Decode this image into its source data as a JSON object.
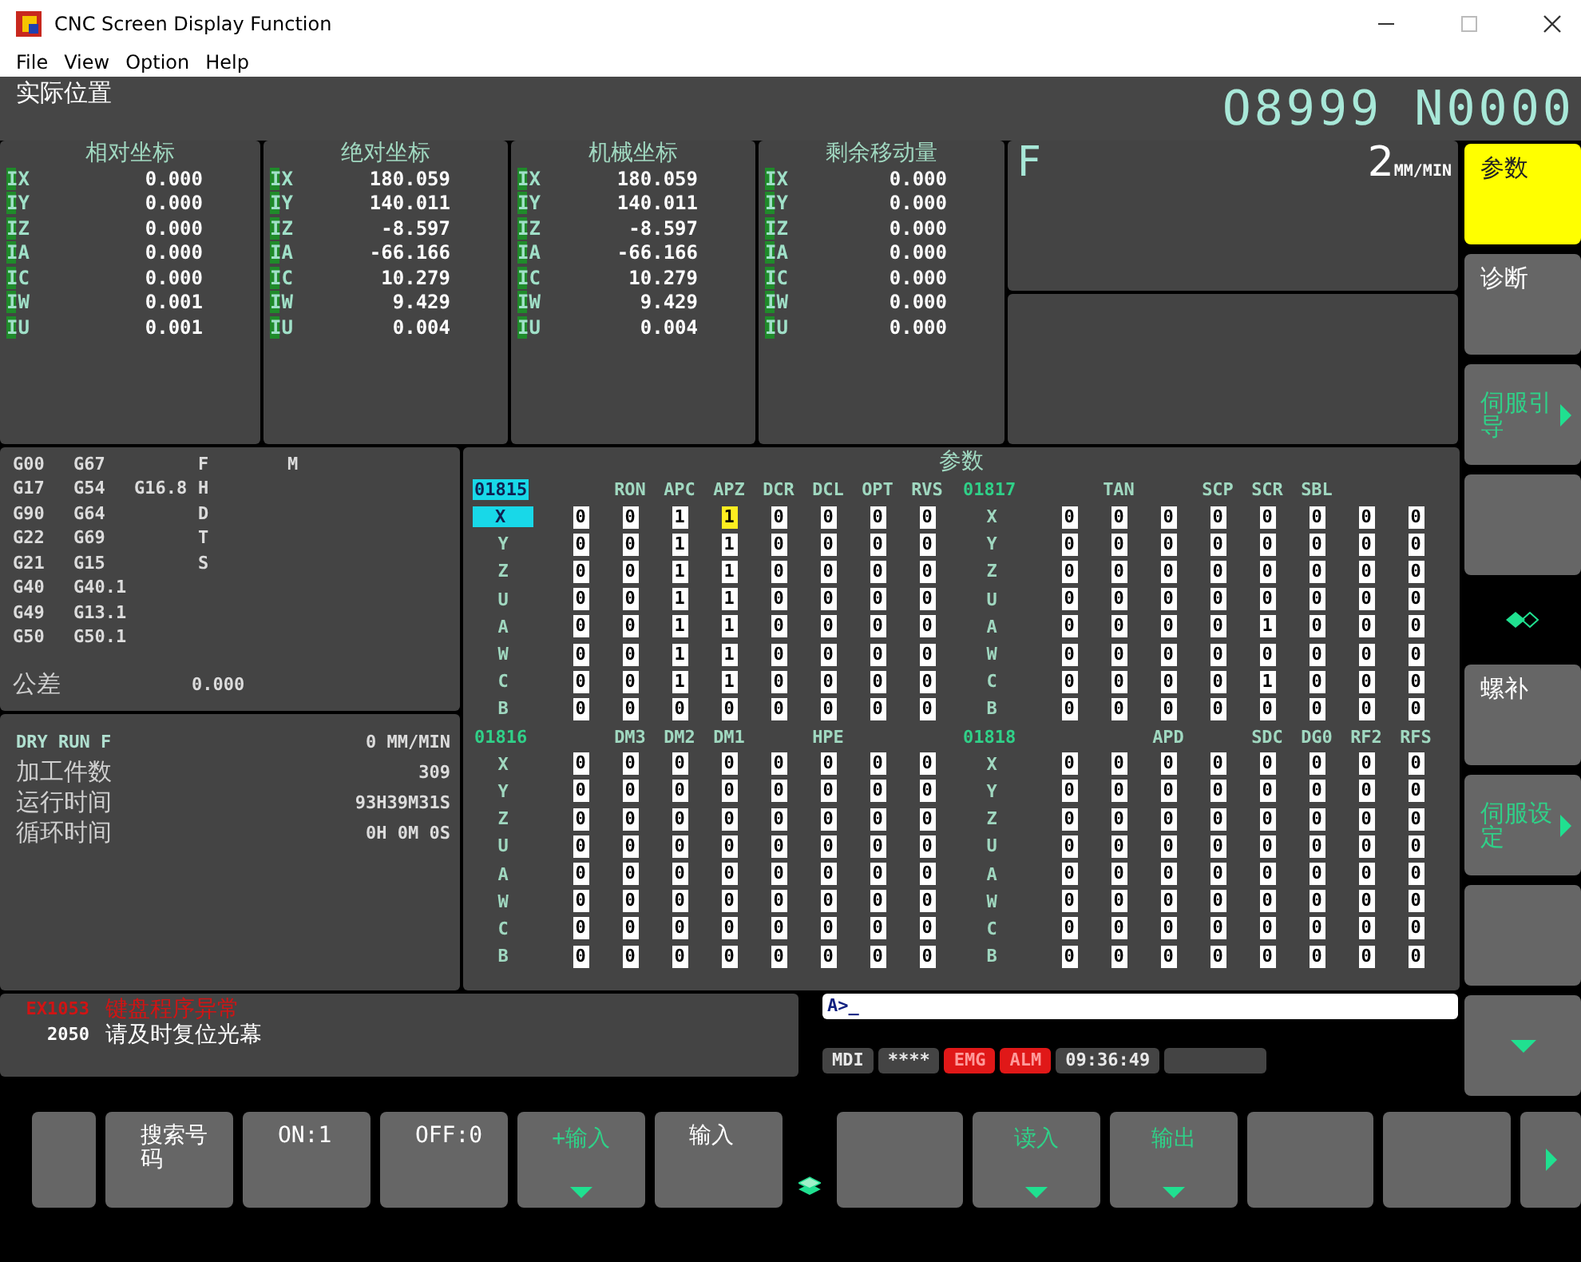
{
  "window": {
    "title": "CNC Screen Display Function"
  },
  "menu": [
    "File",
    "View",
    "Option",
    "Help"
  ],
  "header": {
    "title": "实际位置",
    "program": "O8999 N0000"
  },
  "coordinates": [
    {
      "title": "相对坐标",
      "rows": [
        {
          "axis": "IX",
          "value": "0.000"
        },
        {
          "axis": "IY",
          "value": "0.000"
        },
        {
          "axis": "IZ",
          "value": "0.000"
        },
        {
          "axis": "IA",
          "value": "0.000"
        },
        {
          "axis": "IC",
          "value": "0.000"
        },
        {
          "axis": "IW",
          "value": "0.001"
        },
        {
          "axis": "IU",
          "value": "0.001"
        }
      ]
    },
    {
      "title": "绝对坐标",
      "rows": [
        {
          "axis": "IX",
          "value": "180.059"
        },
        {
          "axis": "IY",
          "value": "140.011"
        },
        {
          "axis": "IZ",
          "value": "-8.597"
        },
        {
          "axis": "IA",
          "value": "-66.166"
        },
        {
          "axis": "IC",
          "value": "10.279"
        },
        {
          "axis": "IW",
          "value": "9.429"
        },
        {
          "axis": "IU",
          "value": "0.004"
        }
      ]
    },
    {
      "title": "机械坐标",
      "rows": [
        {
          "axis": "IX",
          "value": "180.059"
        },
        {
          "axis": "IY",
          "value": "140.011"
        },
        {
          "axis": "IZ",
          "value": "-8.597"
        },
        {
          "axis": "IA",
          "value": "-66.166"
        },
        {
          "axis": "IC",
          "value": "10.279"
        },
        {
          "axis": "IW",
          "value": "9.429"
        },
        {
          "axis": "IU",
          "value": "0.004"
        }
      ]
    },
    {
      "title": "剩余移动量",
      "rows": [
        {
          "axis": "IX",
          "value": "0.000"
        },
        {
          "axis": "IY",
          "value": "0.000"
        },
        {
          "axis": "IZ",
          "value": "0.000"
        },
        {
          "axis": "IA",
          "value": "0.000"
        },
        {
          "axis": "IC",
          "value": "0.000"
        },
        {
          "axis": "IW",
          "value": "0.000"
        },
        {
          "axis": "IU",
          "value": "0.000"
        }
      ]
    }
  ],
  "feed": {
    "label": "F",
    "value": "2",
    "unit": "MM/MIN"
  },
  "modal": [
    {
      "codes": [
        "G00",
        "G67"
      ],
      "address": "F",
      "extra": "M"
    },
    {
      "codes": [
        "G17",
        "G54",
        "G16.8"
      ],
      "address": "H"
    },
    {
      "codes": [
        "G90",
        "G64"
      ],
      "address": "D"
    },
    {
      "codes": [
        "G22",
        "G69"
      ],
      "address": "T"
    },
    {
      "codes": [
        "G21",
        "G15"
      ],
      "address": "S"
    },
    {
      "codes": [
        "G40",
        "G40.1"
      ]
    },
    {
      "codes": [
        "G49",
        "G13.1"
      ]
    },
    {
      "codes": [
        "G50",
        "G50.1"
      ]
    }
  ],
  "tolerance": {
    "label": "公差",
    "value": "0.000"
  },
  "run_info": [
    {
      "label": "DRY RUN F",
      "value": "0 MM/MIN"
    },
    {
      "label": "加工件数",
      "value": "309"
    },
    {
      "label": "运行时间",
      "value": "93H39M31S"
    },
    {
      "label": "循环时间",
      "value": "0H 0M 0S"
    }
  ],
  "parameters": {
    "title": "参数",
    "groups": [
      {
        "number": "01815",
        "selected": true,
        "axes": [
          {
            "axis": "X",
            "selected": true
          },
          {
            "axis": "Y",
            "selected": false
          },
          {
            "axis": "Z",
            "selected": false
          },
          {
            "axis": "U",
            "selected": false
          },
          {
            "axis": "A",
            "selected": false
          },
          {
            "axis": "W",
            "selected": false
          },
          {
            "axis": "C",
            "selected": false
          },
          {
            "axis": "B",
            "selected": false
          }
        ],
        "columns": [
          {
            "bits": [
              {
                "v": "0",
                "selected": false
              },
              {
                "v": "0",
                "selected": false
              },
              {
                "v": "0",
                "selected": false
              },
              {
                "v": "0",
                "selected": false
              },
              {
                "v": "0",
                "selected": false
              },
              {
                "v": "0",
                "selected": false
              },
              {
                "v": "0",
                "selected": false
              },
              {
                "v": "0",
                "selected": false
              }
            ]
          },
          {
            "label": "RON",
            "bits": [
              {
                "v": "0",
                "selected": false
              },
              {
                "v": "0",
                "selected": false
              },
              {
                "v": "0",
                "selected": false
              },
              {
                "v": "0",
                "selected": false
              },
              {
                "v": "0",
                "selected": false
              },
              {
                "v": "0",
                "selected": false
              },
              {
                "v": "0",
                "selected": false
              },
              {
                "v": "0",
                "selected": false
              }
            ]
          },
          {
            "label": "APC",
            "bits": [
              {
                "v": "1",
                "selected": false
              },
              {
                "v": "1",
                "selected": false
              },
              {
                "v": "1",
                "selected": false
              },
              {
                "v": "1",
                "selected": false
              },
              {
                "v": "1",
                "selected": false
              },
              {
                "v": "1",
                "selected": false
              },
              {
                "v": "1",
                "selected": false
              },
              {
                "v": "0",
                "selected": false
              }
            ]
          },
          {
            "label": "APZ",
            "bits": [
              {
                "v": "1",
                "selected": true
              },
              {
                "v": "1",
                "selected": false
              },
              {
                "v": "1",
                "selected": false
              },
              {
                "v": "1",
                "selected": false
              },
              {
                "v": "1",
                "selected": false
              },
              {
                "v": "1",
                "selected": false
              },
              {
                "v": "1",
                "selected": false
              },
              {
                "v": "0",
                "selected": false
              }
            ]
          },
          {
            "label": "DCR",
            "bits": [
              {
                "v": "0",
                "selected": false
              },
              {
                "v": "0",
                "selected": false
              },
              {
                "v": "0",
                "selected": false
              },
              {
                "v": "0",
                "selected": false
              },
              {
                "v": "0",
                "selected": false
              },
              {
                "v": "0",
                "selected": false
              },
              {
                "v": "0",
                "selected": false
              },
              {
                "v": "0",
                "selected": false
              }
            ]
          },
          {
            "label": "DCL",
            "bits": [
              {
                "v": "0",
                "selected": false
              },
              {
                "v": "0",
                "selected": false
              },
              {
                "v": "0",
                "selected": false
              },
              {
                "v": "0",
                "selected": false
              },
              {
                "v": "0",
                "selected": false
              },
              {
                "v": "0",
                "selected": false
              },
              {
                "v": "0",
                "selected": false
              },
              {
                "v": "0",
                "selected": false
              }
            ]
          },
          {
            "label": "OPT",
            "bits": [
              {
                "v": "0",
                "selected": false
              },
              {
                "v": "0",
                "selected": false
              },
              {
                "v": "0",
                "selected": false
              },
              {
                "v": "0",
                "selected": false
              },
              {
                "v": "0",
                "selected": false
              },
              {
                "v": "0",
                "selected": false
              },
              {
                "v": "0",
                "selected": false
              },
              {
                "v": "0",
                "selected": false
              }
            ]
          },
          {
            "label": "RVS",
            "bits": [
              {
                "v": "0",
                "selected": false
              },
              {
                "v": "0",
                "selected": false
              },
              {
                "v": "0",
                "selected": false
              },
              {
                "v": "0",
                "selected": false
              },
              {
                "v": "0",
                "selected": false
              },
              {
                "v": "0",
                "selected": false
              },
              {
                "v": "0",
                "selected": false
              },
              {
                "v": "0",
                "selected": false
              }
            ]
          }
        ]
      },
      {
        "number": "01817",
        "selected": false,
        "axes": [
          {
            "axis": "X",
            "selected": false
          },
          {
            "axis": "Y",
            "selected": false
          },
          {
            "axis": "Z",
            "selected": false
          },
          {
            "axis": "U",
            "selected": false
          },
          {
            "axis": "A",
            "selected": false
          },
          {
            "axis": "W",
            "selected": false
          },
          {
            "axis": "C",
            "selected": false
          },
          {
            "axis": "B",
            "selected": false
          }
        ],
        "columns": [
          {
            "bits": [
              {
                "v": "0",
                "selected": false
              },
              {
                "v": "0",
                "selected": false
              },
              {
                "v": "0",
                "selected": false
              },
              {
                "v": "0",
                "selected": false
              },
              {
                "v": "0",
                "selected": false
              },
              {
                "v": "0",
                "selected": false
              },
              {
                "v": "0",
                "selected": false
              },
              {
                "v": "0",
                "selected": false
              }
            ]
          },
          {
            "label": "TAN",
            "bits": [
              {
                "v": "0",
                "selected": false
              },
              {
                "v": "0",
                "selected": false
              },
              {
                "v": "0",
                "selected": false
              },
              {
                "v": "0",
                "selected": false
              },
              {
                "v": "0",
                "selected": false
              },
              {
                "v": "0",
                "selected": false
              },
              {
                "v": "0",
                "selected": false
              },
              {
                "v": "0",
                "selected": false
              }
            ]
          },
          {
            "bits": [
              {
                "v": "0",
                "selected": false
              },
              {
                "v": "0",
                "selected": false
              },
              {
                "v": "0",
                "selected": false
              },
              {
                "v": "0",
                "selected": false
              },
              {
                "v": "0",
                "selected": false
              },
              {
                "v": "0",
                "selected": false
              },
              {
                "v": "0",
                "selected": false
              },
              {
                "v": "0",
                "selected": false
              }
            ]
          },
          {
            "label": "SCP",
            "bits": [
              {
                "v": "0",
                "selected": false
              },
              {
                "v": "0",
                "selected": false
              },
              {
                "v": "0",
                "selected": false
              },
              {
                "v": "0",
                "selected": false
              },
              {
                "v": "0",
                "selected": false
              },
              {
                "v": "0",
                "selected": false
              },
              {
                "v": "0",
                "selected": false
              },
              {
                "v": "0",
                "selected": false
              }
            ]
          },
          {
            "label": "SCR",
            "bits": [
              {
                "v": "0",
                "selected": false
              },
              {
                "v": "0",
                "selected": false
              },
              {
                "v": "0",
                "selected": false
              },
              {
                "v": "0",
                "selected": false
              },
              {
                "v": "1",
                "selected": false
              },
              {
                "v": "0",
                "selected": false
              },
              {
                "v": "1",
                "selected": false
              },
              {
                "v": "0",
                "selected": false
              }
            ]
          },
          {
            "label": "SBL",
            "bits": [
              {
                "v": "0",
                "selected": false
              },
              {
                "v": "0",
                "selected": false
              },
              {
                "v": "0",
                "selected": false
              },
              {
                "v": "0",
                "selected": false
              },
              {
                "v": "0",
                "selected": false
              },
              {
                "v": "0",
                "selected": false
              },
              {
                "v": "0",
                "selected": false
              },
              {
                "v": "0",
                "selected": false
              }
            ]
          },
          {
            "bits": [
              {
                "v": "0",
                "selected": false
              },
              {
                "v": "0",
                "selected": false
              },
              {
                "v": "0",
                "selected": false
              },
              {
                "v": "0",
                "selected": false
              },
              {
                "v": "0",
                "selected": false
              },
              {
                "v": "0",
                "selected": false
              },
              {
                "v": "0",
                "selected": false
              },
              {
                "v": "0",
                "selected": false
              }
            ]
          },
          {
            "bits": [
              {
                "v": "0",
                "selected": false
              },
              {
                "v": "0",
                "selected": false
              },
              {
                "v": "0",
                "selected": false
              },
              {
                "v": "0",
                "selected": false
              },
              {
                "v": "0",
                "selected": false
              },
              {
                "v": "0",
                "selected": false
              },
              {
                "v": "0",
                "selected": false
              },
              {
                "v": "0",
                "selected": false
              }
            ]
          }
        ]
      },
      {
        "number": "01816",
        "selected": false,
        "axes": [
          {
            "axis": "X",
            "selected": false
          },
          {
            "axis": "Y",
            "selected": false
          },
          {
            "axis": "Z",
            "selected": false
          },
          {
            "axis": "U",
            "selected": false
          },
          {
            "axis": "A",
            "selected": false
          },
          {
            "axis": "W",
            "selected": false
          },
          {
            "axis": "C",
            "selected": false
          },
          {
            "axis": "B",
            "selected": false
          }
        ],
        "columns": [
          {
            "bits": [
              {
                "v": "0",
                "selected": false
              },
              {
                "v": "0",
                "selected": false
              },
              {
                "v": "0",
                "selected": false
              },
              {
                "v": "0",
                "selected": false
              },
              {
                "v": "0",
                "selected": false
              },
              {
                "v": "0",
                "selected": false
              },
              {
                "v": "0",
                "selected": false
              },
              {
                "v": "0",
                "selected": false
              }
            ]
          },
          {
            "label": "DM3",
            "bits": [
              {
                "v": "0",
                "selected": false
              },
              {
                "v": "0",
                "selected": false
              },
              {
                "v": "0",
                "selected": false
              },
              {
                "v": "0",
                "selected": false
              },
              {
                "v": "0",
                "selected": false
              },
              {
                "v": "0",
                "selected": false
              },
              {
                "v": "0",
                "selected": false
              },
              {
                "v": "0",
                "selected": false
              }
            ]
          },
          {
            "label": "DM2",
            "bits": [
              {
                "v": "0",
                "selected": false
              },
              {
                "v": "0",
                "selected": false
              },
              {
                "v": "0",
                "selected": false
              },
              {
                "v": "0",
                "selected": false
              },
              {
                "v": "0",
                "selected": false
              },
              {
                "v": "0",
                "selected": false
              },
              {
                "v": "0",
                "selected": false
              },
              {
                "v": "0",
                "selected": false
              }
            ]
          },
          {
            "label": "DM1",
            "bits": [
              {
                "v": "0",
                "selected": false
              },
              {
                "v": "0",
                "selected": false
              },
              {
                "v": "0",
                "selected": false
              },
              {
                "v": "0",
                "selected": false
              },
              {
                "v": "0",
                "selected": false
              },
              {
                "v": "0",
                "selected": false
              },
              {
                "v": "0",
                "selected": false
              },
              {
                "v": "0",
                "selected": false
              }
            ]
          },
          {
            "bits": [
              {
                "v": "0",
                "selected": false
              },
              {
                "v": "0",
                "selected": false
              },
              {
                "v": "0",
                "selected": false
              },
              {
                "v": "0",
                "selected": false
              },
              {
                "v": "0",
                "selected": false
              },
              {
                "v": "0",
                "selected": false
              },
              {
                "v": "0",
                "selected": false
              },
              {
                "v": "0",
                "selected": false
              }
            ]
          },
          {
            "label": "HPE",
            "bits": [
              {
                "v": "0",
                "selected": false
              },
              {
                "v": "0",
                "selected": false
              },
              {
                "v": "0",
                "selected": false
              },
              {
                "v": "0",
                "selected": false
              },
              {
                "v": "0",
                "selected": false
              },
              {
                "v": "0",
                "selected": false
              },
              {
                "v": "0",
                "selected": false
              },
              {
                "v": "0",
                "selected": false
              }
            ]
          },
          {
            "bits": [
              {
                "v": "0",
                "selected": false
              },
              {
                "v": "0",
                "selected": false
              },
              {
                "v": "0",
                "selected": false
              },
              {
                "v": "0",
                "selected": false
              },
              {
                "v": "0",
                "selected": false
              },
              {
                "v": "0",
                "selected": false
              },
              {
                "v": "0",
                "selected": false
              },
              {
                "v": "0",
                "selected": false
              }
            ]
          },
          {
            "bits": [
              {
                "v": "0",
                "selected": false
              },
              {
                "v": "0",
                "selected": false
              },
              {
                "v": "0",
                "selected": false
              },
              {
                "v": "0",
                "selected": false
              },
              {
                "v": "0",
                "selected": false
              },
              {
                "v": "0",
                "selected": false
              },
              {
                "v": "0",
                "selected": false
              },
              {
                "v": "0",
                "selected": false
              }
            ]
          }
        ]
      },
      {
        "number": "01818",
        "selected": false,
        "axes": [
          {
            "axis": "X",
            "selected": false
          },
          {
            "axis": "Y",
            "selected": false
          },
          {
            "axis": "Z",
            "selected": false
          },
          {
            "axis": "U",
            "selected": false
          },
          {
            "axis": "A",
            "selected": false
          },
          {
            "axis": "W",
            "selected": false
          },
          {
            "axis": "C",
            "selected": false
          },
          {
            "axis": "B",
            "selected": false
          }
        ],
        "columns": [
          {
            "bits": [
              {
                "v": "0",
                "selected": false
              },
              {
                "v": "0",
                "selected": false
              },
              {
                "v": "0",
                "selected": false
              },
              {
                "v": "0",
                "selected": false
              },
              {
                "v": "0",
                "selected": false
              },
              {
                "v": "0",
                "selected": false
              },
              {
                "v": "0",
                "selected": false
              },
              {
                "v": "0",
                "selected": false
              }
            ]
          },
          {
            "bits": [
              {
                "v": "0",
                "selected": false
              },
              {
                "v": "0",
                "selected": false
              },
              {
                "v": "0",
                "selected": false
              },
              {
                "v": "0",
                "selected": false
              },
              {
                "v": "0",
                "selected": false
              },
              {
                "v": "0",
                "selected": false
              },
              {
                "v": "0",
                "selected": false
              },
              {
                "v": "0",
                "selected": false
              }
            ]
          },
          {
            "label": "APD",
            "bits": [
              {
                "v": "0",
                "selected": false
              },
              {
                "v": "0",
                "selected": false
              },
              {
                "v": "0",
                "selected": false
              },
              {
                "v": "0",
                "selected": false
              },
              {
                "v": "0",
                "selected": false
              },
              {
                "v": "0",
                "selected": false
              },
              {
                "v": "0",
                "selected": false
              },
              {
                "v": "0",
                "selected": false
              }
            ]
          },
          {
            "bits": [
              {
                "v": "0",
                "selected": false
              },
              {
                "v": "0",
                "selected": false
              },
              {
                "v": "0",
                "selected": false
              },
              {
                "v": "0",
                "selected": false
              },
              {
                "v": "0",
                "selected": false
              },
              {
                "v": "0",
                "selected": false
              },
              {
                "v": "0",
                "selected": false
              },
              {
                "v": "0",
                "selected": false
              }
            ]
          },
          {
            "label": "SDC",
            "bits": [
              {
                "v": "0",
                "selected": false
              },
              {
                "v": "0",
                "selected": false
              },
              {
                "v": "0",
                "selected": false
              },
              {
                "v": "0",
                "selected": false
              },
              {
                "v": "0",
                "selected": false
              },
              {
                "v": "0",
                "selected": false
              },
              {
                "v": "0",
                "selected": false
              },
              {
                "v": "0",
                "selected": false
              }
            ]
          },
          {
            "label": "DG0",
            "bits": [
              {
                "v": "0",
                "selected": false
              },
              {
                "v": "0",
                "selected": false
              },
              {
                "v": "0",
                "selected": false
              },
              {
                "v": "0",
                "selected": false
              },
              {
                "v": "0",
                "selected": false
              },
              {
                "v": "0",
                "selected": false
              },
              {
                "v": "0",
                "selected": false
              },
              {
                "v": "0",
                "selected": false
              }
            ]
          },
          {
            "label": "RF2",
            "bits": [
              {
                "v": "0",
                "selected": false
              },
              {
                "v": "0",
                "selected": false
              },
              {
                "v": "0",
                "selected": false
              },
              {
                "v": "0",
                "selected": false
              },
              {
                "v": "0",
                "selected": false
              },
              {
                "v": "0",
                "selected": false
              },
              {
                "v": "0",
                "selected": false
              },
              {
                "v": "0",
                "selected": false
              }
            ]
          },
          {
            "label": "RFS",
            "bits": [
              {
                "v": "0",
                "selected": false
              },
              {
                "v": "0",
                "selected": false
              },
              {
                "v": "0",
                "selected": false
              },
              {
                "v": "0",
                "selected": false
              },
              {
                "v": "0",
                "selected": false
              },
              {
                "v": "0",
                "selected": false
              },
              {
                "v": "0",
                "selected": false
              },
              {
                "v": "0",
                "selected": false
              }
            ]
          }
        ]
      }
    ]
  },
  "messages": [
    {
      "code": "EX1053",
      "text": "键盘程序异常",
      "color": "#d01414"
    },
    {
      "code": "2050",
      "text": "请及时复位光幕",
      "color": "#ffffff"
    }
  ],
  "key_input": {
    "value": "A>_"
  },
  "status": [
    {
      "text": "MDI",
      "alarm": false
    },
    {
      "text": "****",
      "alarm": false
    },
    {
      "text": "EMG",
      "alarm": true
    },
    {
      "text": "ALM",
      "alarm": true
    },
    {
      "text": "09:36:49",
      "alarm": false
    },
    {
      "alarm": false
    }
  ],
  "side_keys": [
    {
      "label": "参数",
      "kind": "plain",
      "selected": true
    },
    {
      "label": "诊断",
      "kind": "plain",
      "selected": false
    },
    {
      "label": "伺服引导",
      "kind": "submenu",
      "selected": false
    },
    {
      "kind": "blank",
      "selected": false
    },
    {
      "kind": "toggle",
      "selected": false
    },
    {
      "label": "螺补",
      "kind": "plain",
      "selected": false
    },
    {
      "label": "伺服设定",
      "kind": "submenu",
      "selected": false
    },
    {
      "kind": "blank",
      "selected": false
    },
    {
      "kind": "arrow_down",
      "selected": false
    }
  ],
  "soft_keys": [
    {
      "kind": "blank"
    },
    {
      "label": "搜索号码",
      "kind": "plain"
    },
    {
      "label": "ON:1",
      "kind": "plain"
    },
    {
      "label": "OFF:0",
      "kind": "plain"
    },
    {
      "label": "+输入",
      "kind": "dropdown"
    },
    {
      "label": "输入",
      "kind": "plain"
    },
    {
      "kind": "layers"
    },
    {
      "kind": "blank"
    },
    {
      "label": "读入",
      "kind": "dropdown"
    },
    {
      "label": "输出",
      "kind": "dropdown"
    },
    {
      "kind": "blank"
    },
    {
      "kind": "blank"
    },
    {
      "kind": "arrow_right"
    }
  ]
}
